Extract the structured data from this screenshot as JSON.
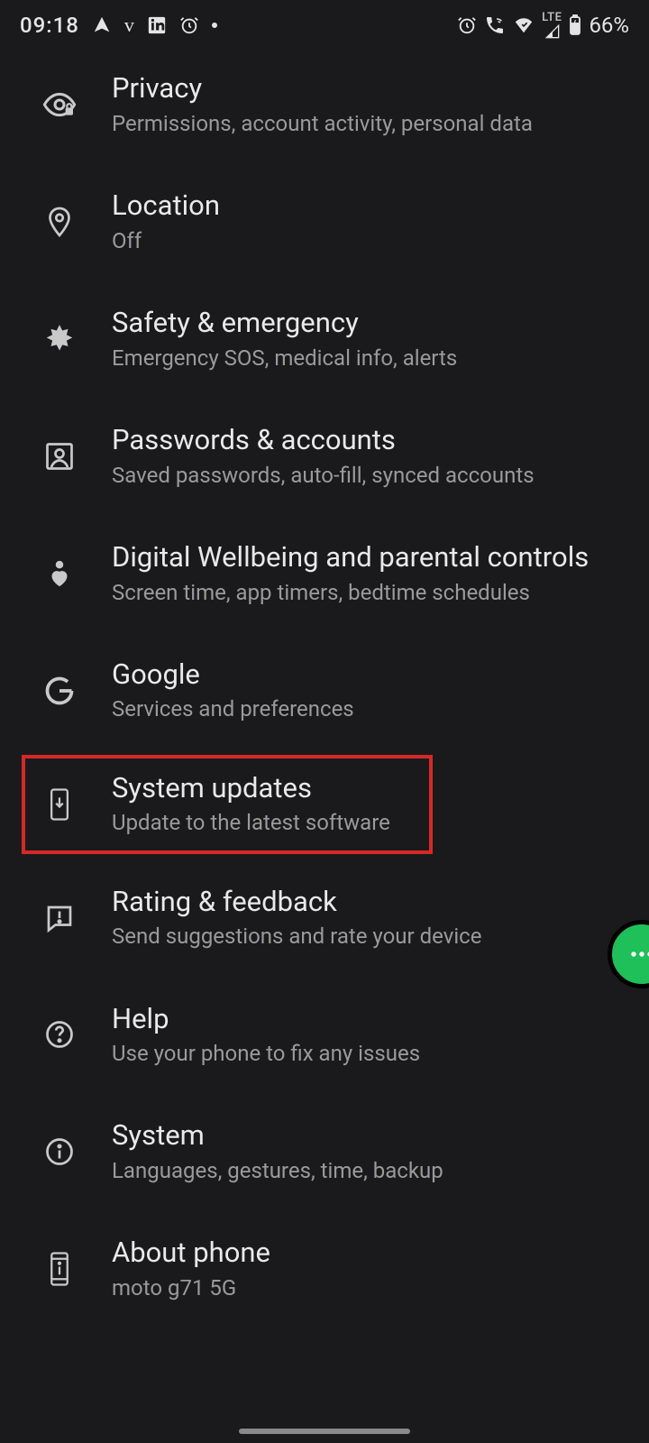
{
  "status": {
    "time": "09:18",
    "lte": "LTE",
    "battery": "66%"
  },
  "items": [
    {
      "title": "Privacy",
      "subtitle": "Permissions, account activity, personal data"
    },
    {
      "title": "Location",
      "subtitle": "Off"
    },
    {
      "title": "Safety & emergency",
      "subtitle": "Emergency SOS, medical info, alerts"
    },
    {
      "title": "Passwords & accounts",
      "subtitle": "Saved passwords, auto-fill, synced accounts"
    },
    {
      "title": "Digital Wellbeing and parental controls",
      "subtitle": "Screen time, app timers, bedtime schedules"
    },
    {
      "title": "Google",
      "subtitle": "Services and preferences"
    },
    {
      "title": "System updates",
      "subtitle": "Update to the latest software"
    },
    {
      "title": "Rating & feedback",
      "subtitle": "Send suggestions and rate your device"
    },
    {
      "title": "Help",
      "subtitle": "Use your phone to fix any issues"
    },
    {
      "title": "System",
      "subtitle": "Languages, gestures, time, backup"
    },
    {
      "title": "About phone",
      "subtitle": "moto g71 5G"
    }
  ],
  "highlighted_index": 6
}
